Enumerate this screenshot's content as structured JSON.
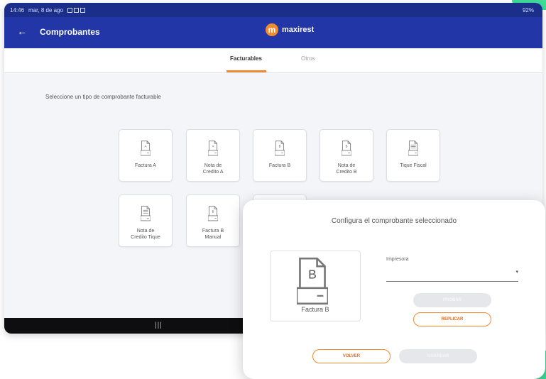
{
  "status_bar": {
    "time": "14:46",
    "date": "mar, 8 de ago",
    "right": "92%"
  },
  "app_bar": {
    "title": "Comprobantes",
    "brand": "maxirest",
    "brand_initial": "m"
  },
  "tabs": [
    {
      "label": "Facturables",
      "active": true
    },
    {
      "label": "Otros",
      "active": false
    }
  ],
  "prompt": "Seleccione un tipo de comprobante facturable",
  "voucher_types": [
    {
      "label": "Factura A",
      "letter": "A"
    },
    {
      "label": "Nota de Credito A",
      "letter": "A"
    },
    {
      "label": "Factura B",
      "letter": "B"
    },
    {
      "label": "Nota de Credito B",
      "letter": "B"
    },
    {
      "label": "Tique Fiscal",
      "letter": ""
    },
    {
      "label": "Nota de Credito Tique",
      "letter": ""
    },
    {
      "label": "Factura B Manual",
      "letter": "B"
    }
  ],
  "dialog": {
    "title": "Configura el comprobante seleccionado",
    "selected_label": "Factura B",
    "selected_letter": "B",
    "printer_label": "Impresora",
    "printer_value": "",
    "test_button": "PROBAR",
    "replicate_button": "REPLICAR",
    "back_button": "VOLVER",
    "save_button": "GUARDAR"
  },
  "colors": {
    "header": "#2236a8",
    "status": "#1a2e8a",
    "accent": "#f28a2e",
    "corner": "#3ddc97"
  },
  "icons": {
    "back": "arrow-left-icon",
    "document": "document-icon",
    "dropdown": "chevron-down-icon"
  }
}
